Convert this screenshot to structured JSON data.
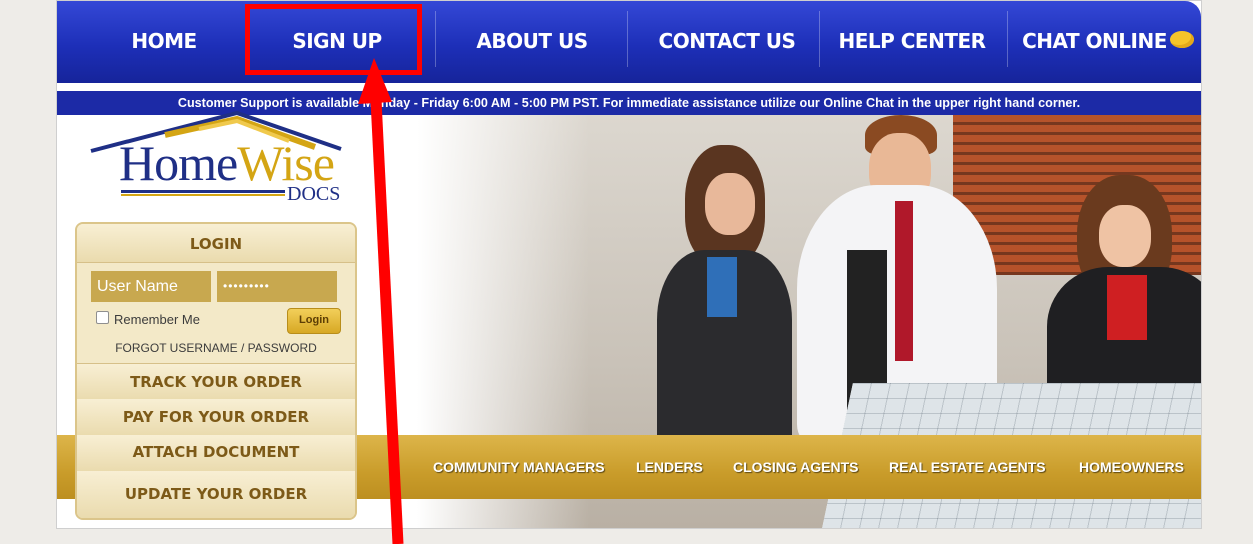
{
  "nav": {
    "items": [
      {
        "label": "HOME"
      },
      {
        "label": "SIGN UP"
      },
      {
        "label": "ABOUT US"
      },
      {
        "label": "CONTACT US"
      },
      {
        "label": "HELP CENTER"
      },
      {
        "label": "CHAT ONLINE"
      }
    ]
  },
  "support_text": "Customer Support is available Monday - Friday 6:00 AM - 5:00 PM PST. For immediate assistance utilize our Online Chat in the upper right hand corner.",
  "logo": {
    "word1": "Home",
    "word2": "Wise",
    "docs": "DOCS"
  },
  "login": {
    "title": "LOGIN",
    "username_placeholder": "User Name",
    "password_value": "•••••••••",
    "remember_label": "Remember Me",
    "login_button": "Login",
    "forgot_label": "FORGOT USERNAME / PASSWORD"
  },
  "panel_links": {
    "track": "TRACK YOUR ORDER",
    "pay": "PAY FOR YOUR ORDER",
    "attach": "ATTACH DOCUMENT",
    "update": "UPDATE YOUR ORDER"
  },
  "audiences": [
    "COMMUNITY MANAGERS",
    "LENDERS",
    "CLOSING AGENTS",
    "REAL ESTATE AGENTS",
    "HOMEOWNERS"
  ],
  "colors": {
    "nav_blue": "#1d2fb8",
    "gold": "#c99c2a",
    "annotation_red": "#ff0000"
  }
}
